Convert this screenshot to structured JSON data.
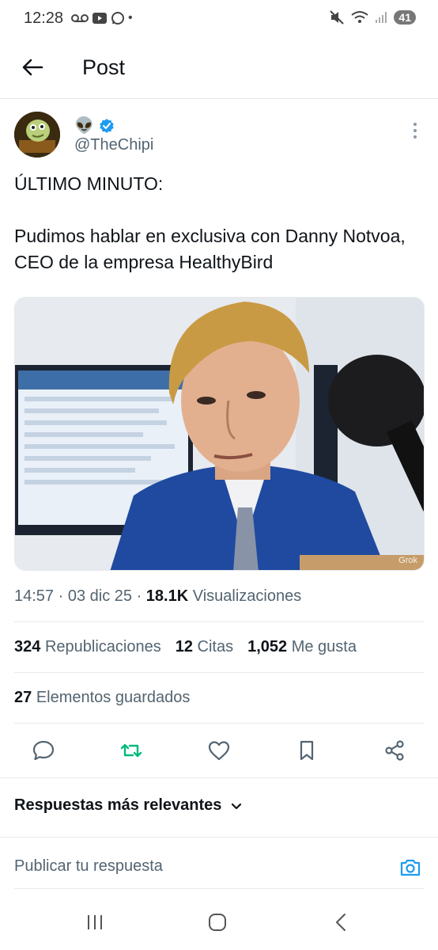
{
  "status_bar": {
    "time": "12:28",
    "battery": "41"
  },
  "header": {
    "title": "Post"
  },
  "author": {
    "display_emoji": "👽",
    "handle": "@TheChipi"
  },
  "post": {
    "text": "ÚLTIMO MINUTO:\n\nPudimos hablar en exclusiva con Danny Notvoa, CEO de la empresa HealthyBird",
    "media_watermark": "Grok"
  },
  "meta": {
    "time": "14:57",
    "date": "03 dic 25",
    "views_count": "18.1K",
    "views_label": "Visualizaciones"
  },
  "stats": {
    "reposts_count": "324",
    "reposts_label": "Republicaciones",
    "quotes_count": "12",
    "quotes_label": "Citas",
    "likes_count": "1,052",
    "likes_label": "Me gusta",
    "saved_count": "27",
    "saved_label": "Elementos guardados"
  },
  "replies": {
    "sort_label": "Respuestas más relevantes",
    "input_placeholder": "Publicar tu respuesta"
  },
  "colors": {
    "accent": "#1d9bf0",
    "repost_green": "#00ba7c",
    "text_secondary": "#536471"
  }
}
